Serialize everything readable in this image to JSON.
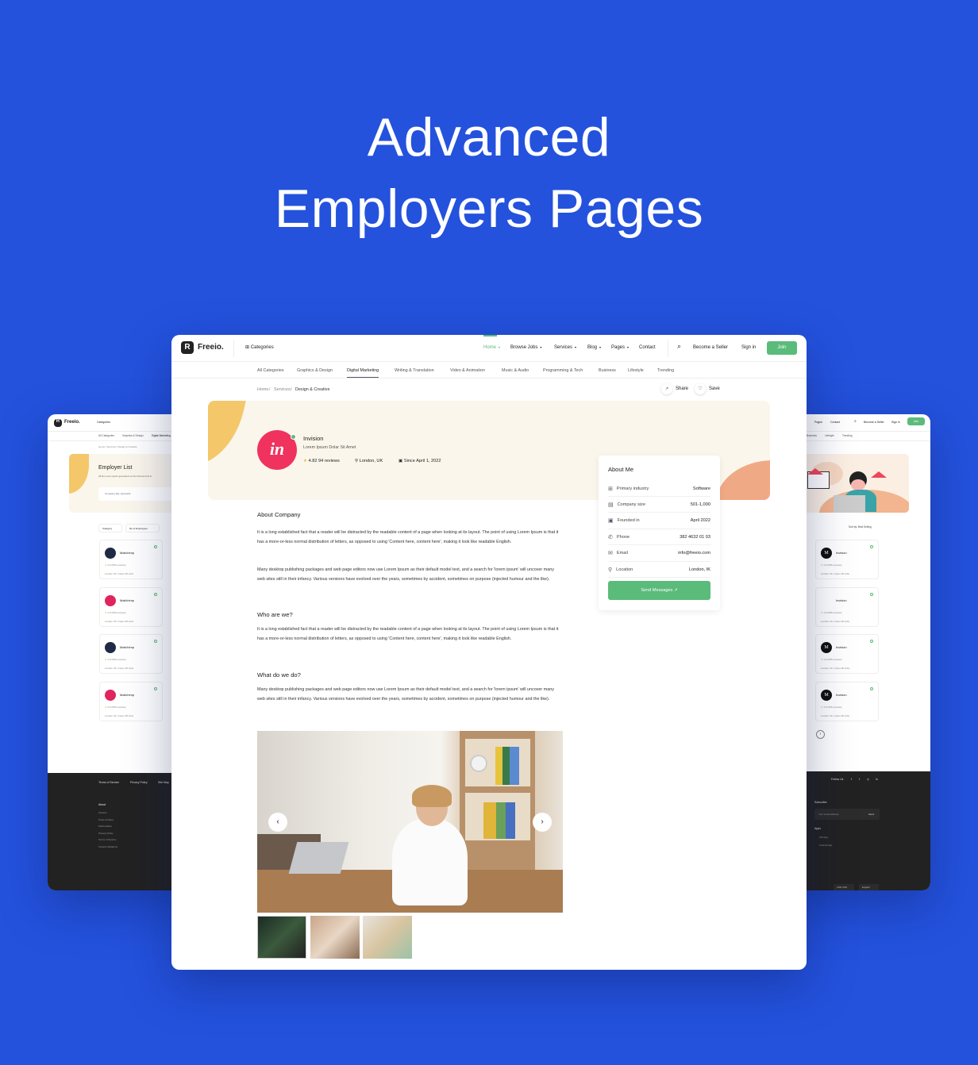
{
  "hero": {
    "line1": "Advanced",
    "line2": "Employers Pages"
  },
  "colors": {
    "background": "#2452dd",
    "accent": "#5bbb7b",
    "avatar": "#f0325e",
    "banner": "#fbf6ec",
    "footer": "#222222"
  },
  "main": {
    "brand": "Freeio.",
    "categories_label": "Categories",
    "nav": [
      {
        "label": "Home",
        "active": true
      },
      {
        "label": "Browse Jobs"
      },
      {
        "label": "Services"
      },
      {
        "label": "Blog"
      },
      {
        "label": "Pages"
      },
      {
        "label": "Contact"
      }
    ],
    "become_seller": "Become a Seller",
    "sign_in": "Sign in",
    "join": "Join",
    "cat_tabs": [
      "All Categories",
      "Graphics & Design",
      "Digital Marketing",
      "Writing & Translation",
      "Video & Animation",
      "Music & Audio",
      "Programming & Tech",
      "Business",
      "Lifestyle",
      "Trending"
    ],
    "active_cat": "Digital Marketing",
    "breadcrumb": [
      "Home",
      "Services",
      "Design & Creative"
    ],
    "share": "Share",
    "save": "Save",
    "profile": {
      "logo_text": "in",
      "name": "Invision",
      "tagline": "Lorem Ipsum Dolar Sit Amet",
      "rating": "4.82 94 reviews",
      "location": "London, UK",
      "since": "Since April 1, 2022"
    },
    "about_me": {
      "title": "About Me",
      "rows": [
        {
          "label": "Primary industry",
          "value": "Software",
          "icon": "grid-icon"
        },
        {
          "label": "Company size",
          "value": "501-1,000",
          "icon": "chart-icon"
        },
        {
          "label": "Founded in",
          "value": "April 2022",
          "icon": "calendar-icon"
        },
        {
          "label": "Phone",
          "value": "382 4632 01 03",
          "icon": "phone-icon"
        },
        {
          "label": "Email",
          "value": "info@freeio.com",
          "icon": "mail-icon"
        },
        {
          "label": "Location",
          "value": "London, IK",
          "icon": "pin-icon"
        }
      ],
      "button": "Send Messages"
    },
    "sections": [
      {
        "title": "About Company",
        "paras": [
          "It is a long established fact that a reader will be distracted by the readable content of a page when looking at its layout. The point of using Lorem Ipsum is that it has a more-or-less normal distribution of letters, as opposed to using 'Content here, content here', making it look like readable English.",
          "Many desktop publishing packages and web page editors now use Lorem Ipsum as their default model text, and a search for 'lorem ipsum' will uncover many web sites still in their infancy. Various versions have evolved over the years, sometimes by accident, sometimes on purpose (injected humour and the like)."
        ]
      },
      {
        "title": "Who are we?",
        "paras": [
          "It is a long established fact that a reader will be distracted by the readable content of a page when looking at its layout. The point of using Lorem Ipsum is that it has a more-or-less normal distribution of letters, as opposed to using 'Content here, content here', making it look like readable English."
        ]
      },
      {
        "title": "What do we do?",
        "paras": [
          "Many desktop publishing packages and web page editors now use Lorem Ipsum as their default model text, and a search for 'lorem ipsum' will uncover many web sites still in their infancy. Various versions have evolved over the years, sometimes by accident, sometimes on purpose (injected humour and the like)."
        ]
      }
    ]
  },
  "left": {
    "brand": "Freeio.",
    "categories_label": "Categories",
    "cat_tabs": [
      "All Categories",
      "Graphics & Design",
      "Digital Marketing"
    ],
    "breadcrumb": "Home / Services / Design & Creative",
    "title": "Employer List",
    "subtitle": "All the Lorem Ipsum generators on the Internet tend to",
    "search_placeholder": "Company title, keywords",
    "filters": [
      "Category",
      "No of Employees"
    ],
    "cards": [
      {
        "name": "Mailchimp",
        "rating": "4.9 (595 reviews)",
        "meta": "London UK  |  Open 28 Jobs"
      },
      {
        "name": "Mailchimp",
        "rating": "4.9 (595 reviews)",
        "meta": "London UK  |  Open 28 Jobs"
      },
      {
        "name": "Mailchimp",
        "rating": "4.9 (595 reviews)",
        "meta": "London UK  |  Open 28 Jobs"
      },
      {
        "name": "Mailchimp",
        "rating": "4.9 (595 reviews)",
        "meta": "London UK  |  Open 28 Jobs"
      }
    ],
    "footer_links": [
      "Terms of Service",
      "Privacy Policy",
      "Site Map"
    ],
    "about_title": "About",
    "about_links": [
      "Careers",
      "Press & News",
      "Partnerships",
      "Privacy Policy",
      "Terms of Service",
      "Investor Relations"
    ]
  },
  "right": {
    "nav": [
      "Pages",
      "Contact"
    ],
    "become_seller": "Become a Seller",
    "sign_in": "Sign in",
    "join": "Join",
    "cat_tabs": [
      "Business",
      "Lifestyle",
      "Trending"
    ],
    "sort": "Sort by: Best Selling",
    "cards": [
      {
        "name": "Invision",
        "rating": "4.9 (595 reviews)",
        "meta": "London UK  |  Open 28 Jobs",
        "logo": "M"
      },
      {
        "name": "Invision",
        "rating": "4.9 (595 reviews)",
        "meta": "London UK  |  Open 28 Jobs",
        "logo": ""
      },
      {
        "name": "Invision",
        "rating": "4.9 (595 reviews)",
        "meta": "London UK  |  Open 28 Jobs",
        "logo": "M"
      },
      {
        "name": "Invision",
        "rating": "4.9 (595 reviews)",
        "meta": "London UK  |  Open 28 Jobs",
        "logo": "M"
      }
    ],
    "follow": "Follow Us",
    "subscribe": "Subscribe",
    "email_placeholder": "Your email address",
    "send": "Send",
    "apps_title": "Apps",
    "apps": [
      "iOS App",
      "Android App"
    ],
    "currency": "US$ USD",
    "language": "English"
  }
}
